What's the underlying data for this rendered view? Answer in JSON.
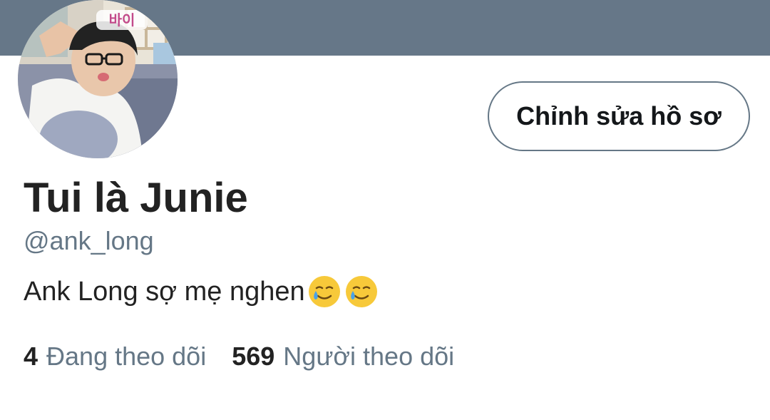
{
  "profile": {
    "display_name": "Tui là Junie",
    "handle": "@ank_long",
    "bio": "Ank Long sợ mẹ nghen",
    "bio_emojis": [
      "smiling-face-with-tear-icon",
      "smiling-face-with-tear-icon"
    ],
    "avatar_caption": "바이",
    "edit_button_label": "Chỉnh sửa hồ sơ"
  },
  "stats": {
    "following_count": "4",
    "following_label": "Đang theo dõi",
    "followers_count": "569",
    "followers_label": "Người theo dõi"
  },
  "colors": {
    "banner": "#667788",
    "secondary_text": "#657786",
    "primary_text": "#222222"
  }
}
